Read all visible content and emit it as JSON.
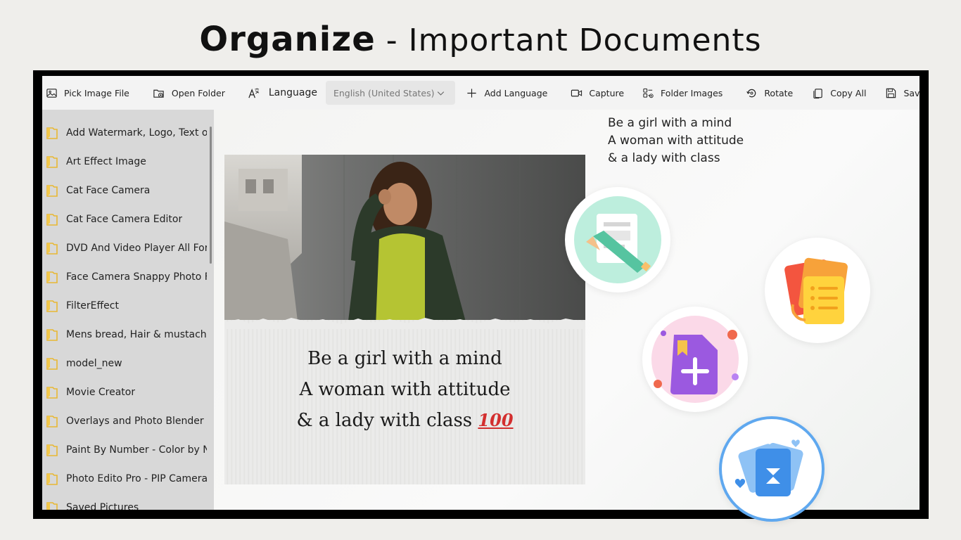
{
  "banner": {
    "bold": "Organize",
    "rest": " - Important Documents"
  },
  "toolbar": {
    "pick_image_file": "Pick Image File",
    "open_folder": "Open Folder",
    "language": "Language",
    "language_selected": "English (United States)",
    "add_language": "Add Language",
    "capture": "Capture",
    "folder_images": "Folder Images",
    "rotate": "Rotate",
    "copy_all": "Copy All",
    "save": "Save",
    "more": "···"
  },
  "sidebar": {
    "items": [
      {
        "label": "Add Watermark, Logo, Text on I"
      },
      {
        "label": "Art Effect Image"
      },
      {
        "label": "Cat Face Camera"
      },
      {
        "label": "Cat Face Camera Editor"
      },
      {
        "label": "DVD And Video Player All Form"
      },
      {
        "label": "Face Camera Snappy Photo Filt"
      },
      {
        "label": "FilterEffect"
      },
      {
        "label": "Mens bread, Hair & mustache"
      },
      {
        "label": "model_new"
      },
      {
        "label": "Movie Creator"
      },
      {
        "label": "Overlays and Photo Blender"
      },
      {
        "label": "Paint By Number - Color by Nu"
      },
      {
        "label": "Photo Edito Pro - PIP Camera E"
      },
      {
        "label": "Saved Pictures"
      }
    ]
  },
  "image_quote": {
    "line1": "Be a girl with a mind",
    "line2": "A woman with attitude",
    "line3": "& a lady with class",
    "emoji": "100"
  },
  "ocr_text": {
    "line1": "Be a girl with a mind",
    "line2": "A woman with attitude",
    "line3": "& a lady with class"
  },
  "colors": {
    "accent_green": "#6fd3b3",
    "accent_orange": "#f39a2c",
    "accent_purple": "#9b59e0",
    "accent_blue": "#3f8fe8",
    "folder_yellow": "#f2c84b"
  }
}
